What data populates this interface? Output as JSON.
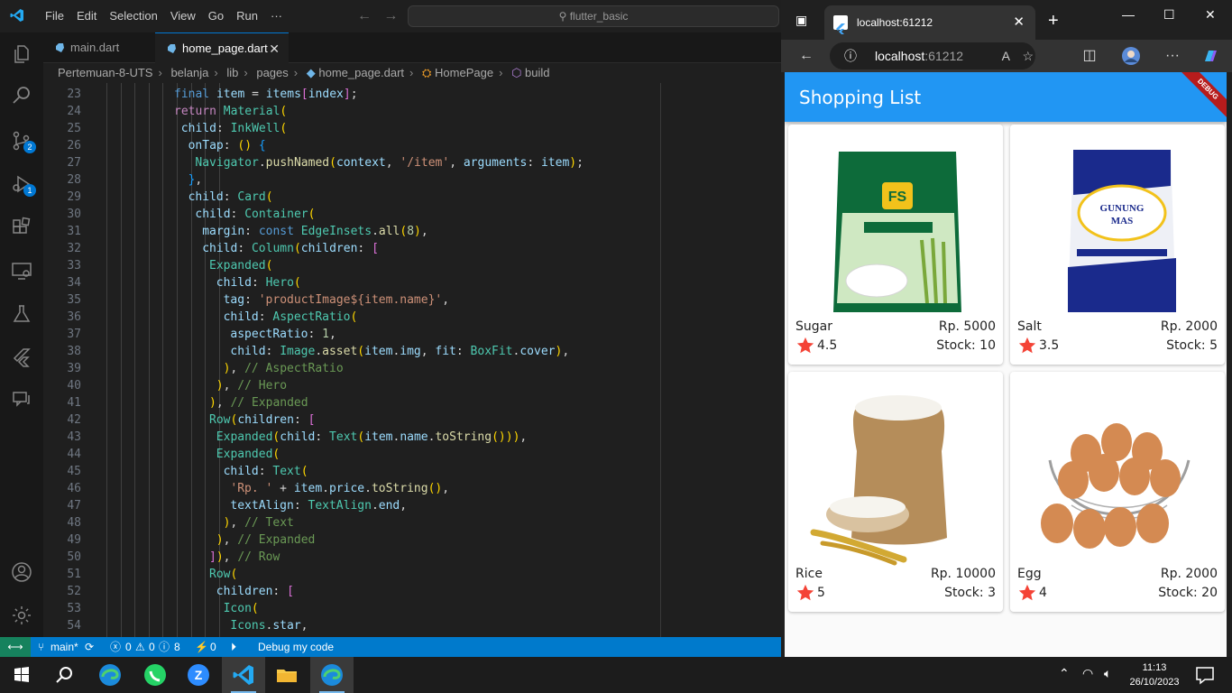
{
  "vscode": {
    "menu": [
      "File",
      "Edit",
      "Selection",
      "View",
      "Go",
      "Run",
      "···"
    ],
    "search_text": "flutter_basic",
    "tabs": [
      {
        "label": "main.dart",
        "active": false
      },
      {
        "label": "home_page.dart",
        "active": true
      }
    ],
    "breadcrumb": [
      "Pertemuan-8-UTS",
      "belanja",
      "lib",
      "pages",
      "home_page.dart",
      "HomePage",
      "build"
    ],
    "badges": {
      "source_control": "2",
      "run_debug": "1"
    },
    "first_line": 23,
    "code_lines": [
      "final item = items[index];",
      "return Material(",
      "child: InkWell(",
      "onTap: () {",
      "Navigator.pushNamed(context, '/item', arguments: item);",
      "},",
      "child: Card(",
      "child: Container(",
      "margin: const EdgeInsets.all(8),",
      "child: Column(children: [",
      "Expanded(",
      "child: Hero(",
      "tag: 'productImage${item.name}',",
      "child: AspectRatio(",
      "aspectRatio: 1,",
      "child: Image.asset(item.img, fit: BoxFit.cover),",
      "), // AspectRatio",
      "), // Hero",
      "), // Expanded",
      "Row(children: [",
      "Expanded(child: Text(item.name.toString())),",
      "Expanded(",
      "child: Text(",
      "'Rp. ' + item.price.toString(),",
      "textAlign: TextAlign.end,",
      "), // Text",
      "), // Expanded",
      "]), // Row",
      "Row(",
      "children: [",
      "Icon(",
      "Icons.star,"
    ],
    "status": {
      "branch": "main*",
      "errors": "0",
      "warnings": "0",
      "info": "8",
      "ports": "0",
      "debug_label": "Debug my code"
    }
  },
  "browser": {
    "tab_title": "localhost:61212",
    "url_host": "localhost",
    "url_port": ":61212",
    "accent": "#2196f3"
  },
  "app": {
    "title": "Shopping List",
    "debug_banner": "DEBUG",
    "products": [
      {
        "name": "Sugar",
        "price": "Rp. 5000",
        "rating": "4.5",
        "stock": "Stock: 10",
        "image": "sugar-package"
      },
      {
        "name": "Salt",
        "price": "Rp. 2000",
        "rating": "3.5",
        "stock": "Stock: 5",
        "image": "salt-package"
      },
      {
        "name": "Rice",
        "price": "Rp. 10000",
        "rating": "5",
        "stock": "Stock: 3",
        "image": "rice-sack"
      },
      {
        "name": "Egg",
        "price": "Rp. 2000",
        "rating": "4",
        "stock": "Stock: 20",
        "image": "egg-basket"
      }
    ]
  },
  "taskbar": {
    "time": "11:13",
    "date": "26/10/2023"
  }
}
